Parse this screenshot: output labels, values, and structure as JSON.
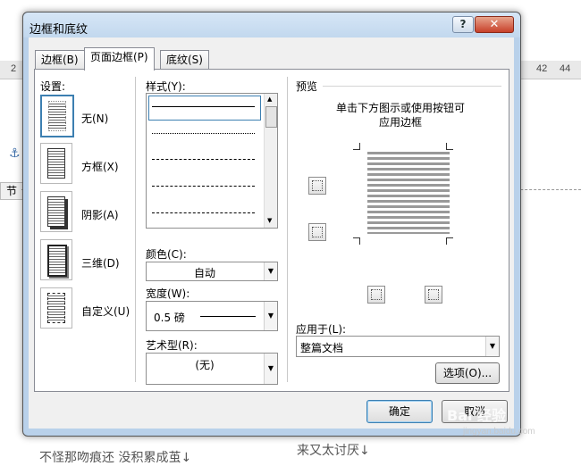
{
  "background_doc": {
    "ruler_left": "2",
    "ruler_42": "42",
    "ruler_44": "44",
    "side_tab": "节",
    "bottom_line_1": "不怪那吻痕还 没积累成茧↓",
    "bottom_line_2": "来又太讨厌↓"
  },
  "dialog": {
    "title": "边框和底纹",
    "help": "?",
    "close": "✕",
    "tabs": [
      "边框(B)",
      "页面边框(P)",
      "底纹(S)"
    ],
    "active_tab": 1
  },
  "settings": {
    "heading": "设置:",
    "items": [
      "无(N)",
      "方框(X)",
      "阴影(A)",
      "三维(D)",
      "自定义(U)"
    ]
  },
  "style": {
    "heading": "样式(Y):",
    "color_label": "颜色(C):",
    "color_value": "自动",
    "width_label": "宽度(W):",
    "width_value": "0.5 磅",
    "art_label": "艺术型(R):",
    "art_value": "(无)"
  },
  "preview": {
    "heading": "预览",
    "instruction_line1": "单击下方图示或使用按钮可",
    "instruction_line2": "应用边框",
    "apply_label": "应用于(L):",
    "apply_value": "整篇文档",
    "options_button": "选项(O)..."
  },
  "footer": {
    "ok": "确定",
    "cancel": "取消"
  },
  "watermark": {
    "text": "Bai  经验",
    "sub": "jingyan.baidu.com"
  },
  "colors": {
    "accent": "#3c7fb1",
    "dialog_frame": "#b9d1ea",
    "close_red": "#c7402a"
  }
}
